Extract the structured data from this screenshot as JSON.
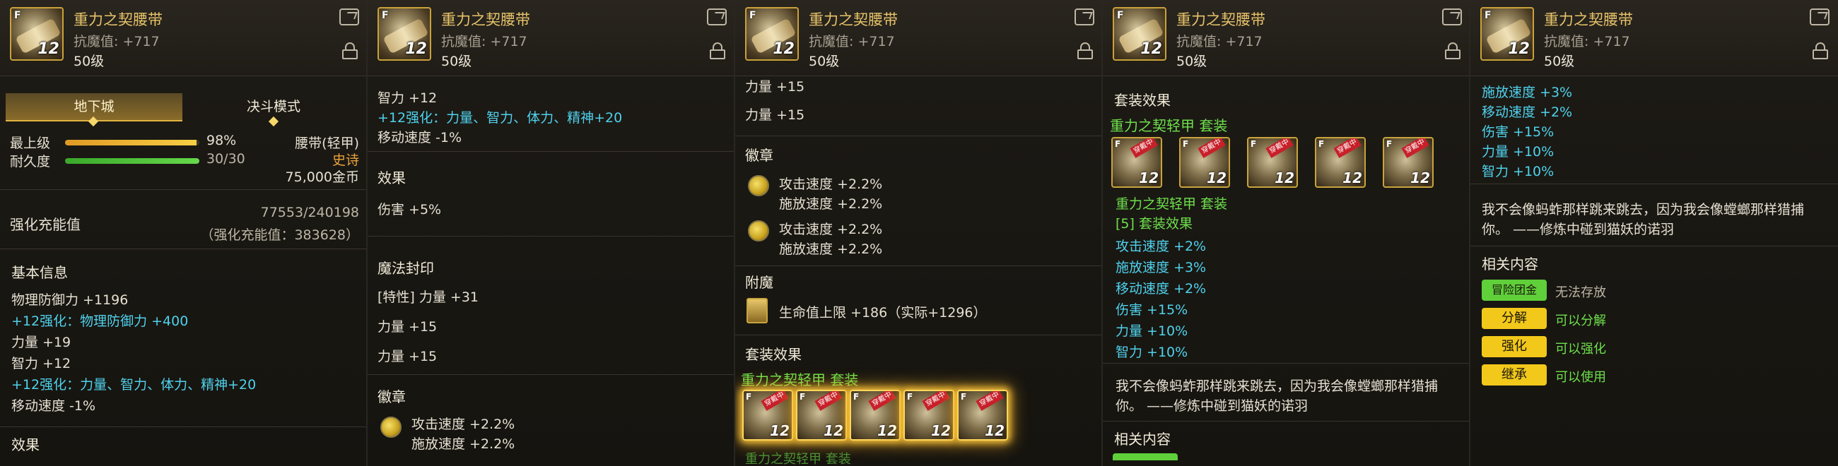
{
  "item": {
    "name": "重力之契腰带",
    "resist": "抗魔值: +717",
    "level": "50级",
    "thumb_f": "F",
    "thumb_lv": "12"
  },
  "panel1": {
    "tabs": [
      "地下城",
      "决斗模式"
    ],
    "stats": [
      {
        "label": "最上级",
        "value": "98%",
        "fill": 0.98
      },
      {
        "label": "耐久度",
        "value": "30/30",
        "fill": 1.0
      }
    ],
    "slot_type": "腰带(轻甲)",
    "rarity": "史诗",
    "price": "75,000金币",
    "charge_label": "强化充能值",
    "charge_value": "77553/240198",
    "charge_sub": "（强化充能值：383628）",
    "basic_title": "基本信息",
    "basic_lines": [
      {
        "text": "物理防御力 +1196",
        "color": "w"
      },
      {
        "text": "+12强化：物理防御力 +400",
        "color": "cy"
      },
      {
        "text": "力量 +19",
        "color": "w"
      },
      {
        "text": "智力 +12",
        "color": "w"
      },
      {
        "text": "+12强化：力量、智力、体力、精神+20",
        "color": "cy"
      },
      {
        "text": "移动速度 -1%",
        "color": "w"
      }
    ],
    "effect_title": "效果"
  },
  "panel2": {
    "top_lines": [
      {
        "text": "智力 +12",
        "color": "w"
      },
      {
        "text": "+12强化：力量、智力、体力、精神+20",
        "color": "cy"
      },
      {
        "text": "移动速度 -1%",
        "color": "w"
      }
    ],
    "effect_title": "效果",
    "effect_line": "伤害 +5%",
    "seal_title": "魔法封印",
    "seal_lines": [
      "[特性] 力量 +31",
      "力量 +15",
      "力量 +15"
    ],
    "emblem_title": "徽章",
    "emblem_lines": [
      "攻击速度 +2.2%",
      "施放速度 +2.2%"
    ]
  },
  "panel3": {
    "top_lines": [
      "力量 +15",
      "力量 +15"
    ],
    "emblem_title": "徽章",
    "emblems": [
      [
        "攻击速度 +2.2%",
        "施放速度 +2.2%"
      ],
      [
        "攻击速度 +2.2%",
        "施放速度 +2.2%"
      ]
    ],
    "enchant_title": "附魔",
    "enchant_line": "生命值上限 +186（实际+1296）",
    "set_title": "套装效果",
    "set_name": "重力之契轻甲 套装"
  },
  "panel4": {
    "set_title": "套装效果",
    "set_name": "重力之契轻甲 套装",
    "set_name2": "重力之契轻甲 套装",
    "set_count": "[5] 套装效果",
    "set_lines": [
      "攻击速度 +2%",
      "施放速度 +3%",
      "移动速度 +2%",
      "伤害 +15%",
      "力量 +10%",
      "智力 +10%"
    ],
    "flavor": [
      "我不会像蚂蚱那样跳来跳去，因为我会像螳螂那样猎捕",
      "你。 ——修炼中碰到猫妖的诺羽"
    ],
    "related_title": "相关内容"
  },
  "panel5": {
    "set_lines": [
      "施放速度 +3%",
      "移动速度 +2%",
      "伤害 +15%",
      "力量 +10%",
      "智力 +10%"
    ],
    "flavor": [
      "我不会像蚂蚱那样跳来跳去，因为我会像螳螂那样猎捕",
      "你。 ——修炼中碰到猫妖的诺羽"
    ],
    "related_title": "相关内容",
    "related": [
      {
        "badge": "冒险团金库",
        "badge_color": "#5fcf3a",
        "text": "无法存放",
        "text_color": "#bdb6a6"
      },
      {
        "badge": "分解",
        "badge_color": "#f2c81a",
        "text": "可以分解",
        "text_color": "#6ee04c"
      },
      {
        "badge": "强化",
        "badge_color": "#f2c81a",
        "text": "可以强化",
        "text_color": "#6ee04c"
      },
      {
        "badge": "继承",
        "badge_color": "#f2c81a",
        "text": "可以使用",
        "text_color": "#6ee04c"
      }
    ]
  },
  "slot_tag": "穿戴中",
  "colors": {
    "gold": "#e8c46a",
    "cyan": "#4fd1ec",
    "green": "#6ee04c",
    "orange": "#e8a23c"
  }
}
